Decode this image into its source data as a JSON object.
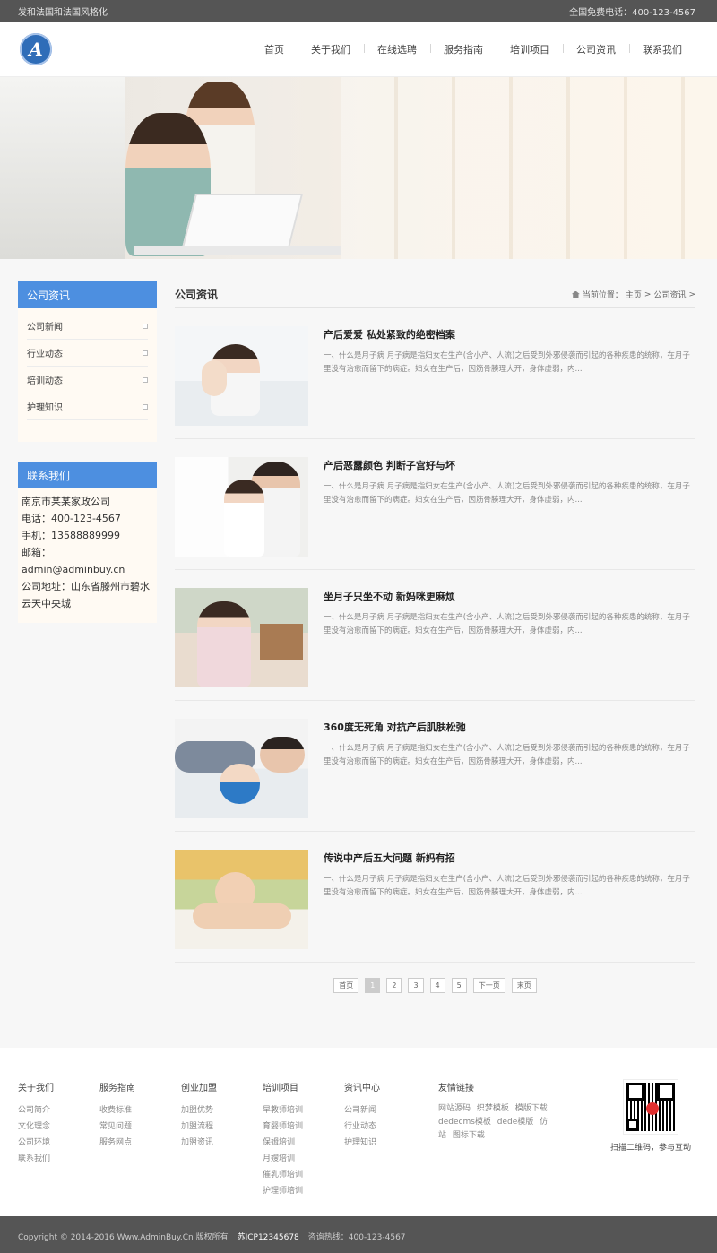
{
  "topbar": {
    "slogan": "发和法国和法国风格化",
    "phone": "全国免费电话：400-123-4567"
  },
  "nav": [
    "首页",
    "关于我们",
    "在线选聘",
    "服务指南",
    "培训项目",
    "公司资讯",
    "联系我们"
  ],
  "logo": {
    "letter": "A"
  },
  "sidebar": {
    "news": {
      "title": "公司资讯",
      "items": [
        "公司新闻",
        "行业动态",
        "培训动态",
        "护理知识"
      ]
    },
    "contact": {
      "title": "联系我们",
      "lines": [
        "南京市某某家政公司",
        "电话：400-123-4567",
        "手机：13588889999",
        "邮箱：admin@adminbuy.cn",
        "公司地址：山东省滕州市碧水云天中央城"
      ]
    }
  },
  "content": {
    "section_title": "公司资讯",
    "breadcrumb": {
      "prefix": "当前位置：",
      "home": "主页",
      "sep": ">",
      "current": "公司资讯",
      "tail": ">"
    },
    "articles": [
      {
        "title": "产后爱爱 私处紧致的绝密档案",
        "desc": "一、什么是月子病 月子病是指妇女在生产(含小产、人流)之后受到外邪侵袭而引起的各种疾患的统称，在月子里没有治愈而留下的病症。妇女在生产后，因筋骨腠理大开，身体虚弱，内..."
      },
      {
        "title": "产后恶露颜色 判断子宫好与坏",
        "desc": "一、什么是月子病 月子病是指妇女在生产(含小产、人流)之后受到外邪侵袭而引起的各种疾患的统称，在月子里没有治愈而留下的病症。妇女在生产后，因筋骨腠理大开，身体虚弱，内..."
      },
      {
        "title": "坐月子只坐不动 新妈咪更麻烦",
        "desc": "一、什么是月子病 月子病是指妇女在生产(含小产、人流)之后受到外邪侵袭而引起的各种疾患的统称，在月子里没有治愈而留下的病症。妇女在生产后，因筋骨腠理大开，身体虚弱，内..."
      },
      {
        "title": "360度无死角 对抗产后肌肤松弛",
        "desc": "一、什么是月子病 月子病是指妇女在生产(含小产、人流)之后受到外邪侵袭而引起的各种疾患的统称，在月子里没有治愈而留下的病症。妇女在生产后，因筋骨腠理大开，身体虚弱，内..."
      },
      {
        "title": "传说中产后五大问题 新妈有招",
        "desc": "一、什么是月子病 月子病是指妇女在生产(含小产、人流)之后受到外邪侵袭而引起的各种疾患的统称，在月子里没有治愈而留下的病症。妇女在生产后，因筋骨腠理大开，身体虚弱，内..."
      }
    ],
    "pager": {
      "first": "首页",
      "pages": [
        "1",
        "2",
        "3",
        "4",
        "5"
      ],
      "current": "1",
      "next": "下一页",
      "last": "末页"
    }
  },
  "footer": {
    "cols": [
      {
        "title": "关于我们",
        "items": [
          "公司简介",
          "文化理念",
          "公司环境",
          "联系我们"
        ]
      },
      {
        "title": "服务指南",
        "items": [
          "收费标准",
          "常见问题",
          "服务网点"
        ]
      },
      {
        "title": "创业加盟",
        "items": [
          "加盟优势",
          "加盟流程",
          "加盟资讯"
        ]
      },
      {
        "title": "培训项目",
        "items": [
          "早教师培训",
          "育婴师培训",
          "保姆培训",
          "月嫂培训",
          "催乳师培训",
          "护理师培训"
        ]
      },
      {
        "title": "资讯中心",
        "items": [
          "公司新闻",
          "行业动态",
          "护理知识"
        ]
      }
    ],
    "links": {
      "title": "友情链接",
      "text": "网站源码 织梦模板 模版下载 dedecms模板 dede模版 仿站 图标下载"
    },
    "qr_caption": "扫描二维码，参与互动"
  },
  "bottombar": {
    "copyright": "Copyright © 2014-2016 Www.AdminBuy.Cn 版权所有",
    "icp": "苏ICP12345678",
    "hotline": "咨询热线：400-123-4567"
  },
  "colors": {
    "accent": "#4d8fe0",
    "topbar": "#555555",
    "sidebar_bg": "#fffaf3"
  }
}
